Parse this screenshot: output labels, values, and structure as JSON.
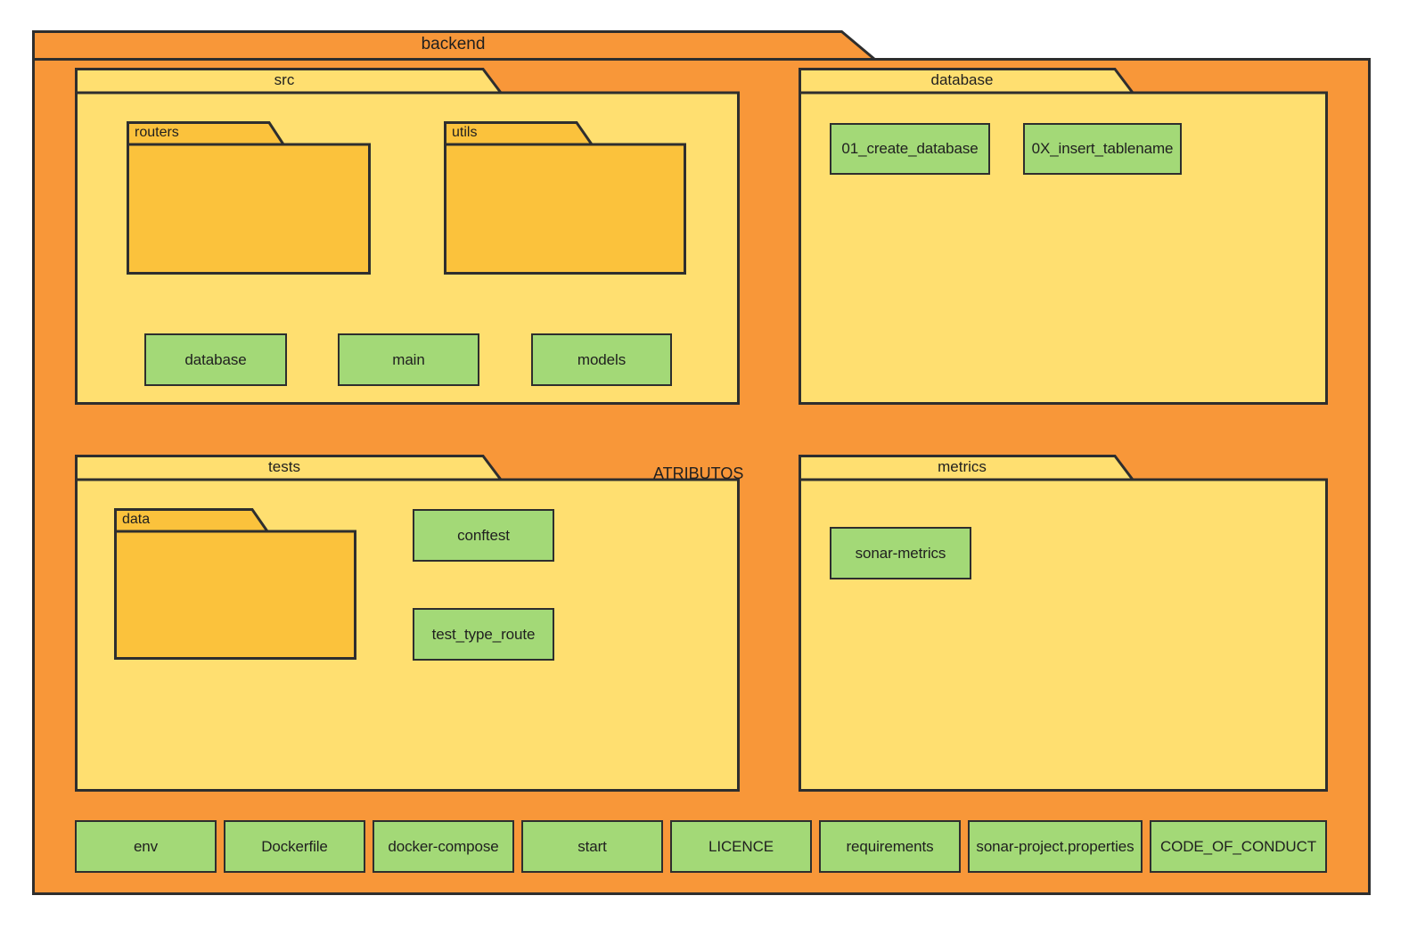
{
  "diagram": {
    "type": "uml-package-diagram",
    "root_label": "backend",
    "floating_label": "ATRIBUTOS",
    "colors": {
      "root_fill": "#f89739",
      "package_fill": "#ffdf70",
      "subpackage_fill": "#fbc23c",
      "leaf_fill": "#a3d977",
      "stroke": "#2e2e2e",
      "text": "#1f1f1f",
      "canvas": "#ffffff"
    }
  },
  "root": {
    "label": "backend"
  },
  "packages": {
    "src": {
      "label": "src",
      "subpackages": [
        {
          "label": "routers"
        },
        {
          "label": "utils"
        }
      ],
      "leaves": [
        {
          "label": "database"
        },
        {
          "label": "main"
        },
        {
          "label": "models"
        }
      ]
    },
    "database": {
      "label": "database",
      "subpackages": [],
      "leaves": [
        {
          "label": "01_create_database"
        },
        {
          "label": "0X_insert_tablename"
        }
      ]
    },
    "tests": {
      "label": "tests",
      "subpackages": [
        {
          "label": "data"
        }
      ],
      "leaves": [
        {
          "label": "conftest"
        },
        {
          "label": "test_type_route"
        }
      ]
    },
    "metrics": {
      "label": "metrics",
      "subpackages": [],
      "leaves": [
        {
          "label": "sonar-metrics"
        }
      ]
    }
  },
  "root_files": [
    {
      "label": "env"
    },
    {
      "label": "Dockerfile"
    },
    {
      "label": "docker-compose"
    },
    {
      "label": "start"
    },
    {
      "label": "LICENCE"
    },
    {
      "label": "requirements"
    },
    {
      "label": "sonar-project.properties"
    },
    {
      "label": "CODE_OF_CONDUCT"
    }
  ]
}
